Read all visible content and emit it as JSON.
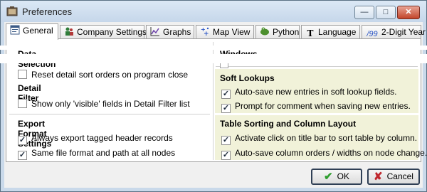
{
  "window": {
    "title": "Preferences",
    "controls": {
      "minimize": "—",
      "maximize": "□",
      "close": "✕"
    }
  },
  "tabs": [
    {
      "label": "General",
      "icon": "general-tab-icon",
      "active": true
    },
    {
      "label": "Company Settings",
      "icon": "company-settings-icon",
      "active": false
    },
    {
      "label": "Graphs",
      "icon": "graphs-icon",
      "active": false
    },
    {
      "label": "Map View",
      "icon": "map-view-icon",
      "active": false
    },
    {
      "label": "Python",
      "icon": "python-icon",
      "active": false
    },
    {
      "label": "Language",
      "icon": "language-icon",
      "glyph": "T",
      "active": false
    },
    {
      "label": "2-Digit Year",
      "icon": "two-digit-year-icon",
      "glyph": "/99",
      "active": false
    }
  ],
  "left": {
    "data_selection": {
      "title": "Data Selection",
      "items": [
        {
          "label": "Reset detail sort orders on program close",
          "checked": false
        }
      ]
    },
    "detail_filter": {
      "title": "Detail Filter",
      "items": [
        {
          "label": "Show only 'visible' fields in Detail Filter list",
          "checked": false
        }
      ]
    },
    "export_format": {
      "title": "Export Format Settings",
      "items": [
        {
          "label": "Always export tagged header records",
          "checked": true
        },
        {
          "label": "Same file format and path at all nodes",
          "checked": true
        }
      ]
    }
  },
  "right": {
    "windows": {
      "title": "Windows"
    },
    "soft_lookups": {
      "title": "Soft Lookups",
      "items": [
        {
          "label": "Auto-save new entries in soft lookup fields.",
          "checked": true
        },
        {
          "label": "Prompt for comment when saving new entries.",
          "checked": true
        }
      ]
    },
    "table_sorting": {
      "title": "Table Sorting and Column Layout",
      "items": [
        {
          "label": "Activate click on title bar to sort table by column.",
          "checked": true
        },
        {
          "label": "Auto-save column orders / widths on node change.",
          "checked": true
        }
      ]
    }
  },
  "buttons": {
    "ok": "OK",
    "cancel": "Cancel"
  },
  "colors": {
    "highlight_panel": "#f1f2d9",
    "ok_check": "#2e9e2e",
    "cancel_x": "#c0272d"
  }
}
